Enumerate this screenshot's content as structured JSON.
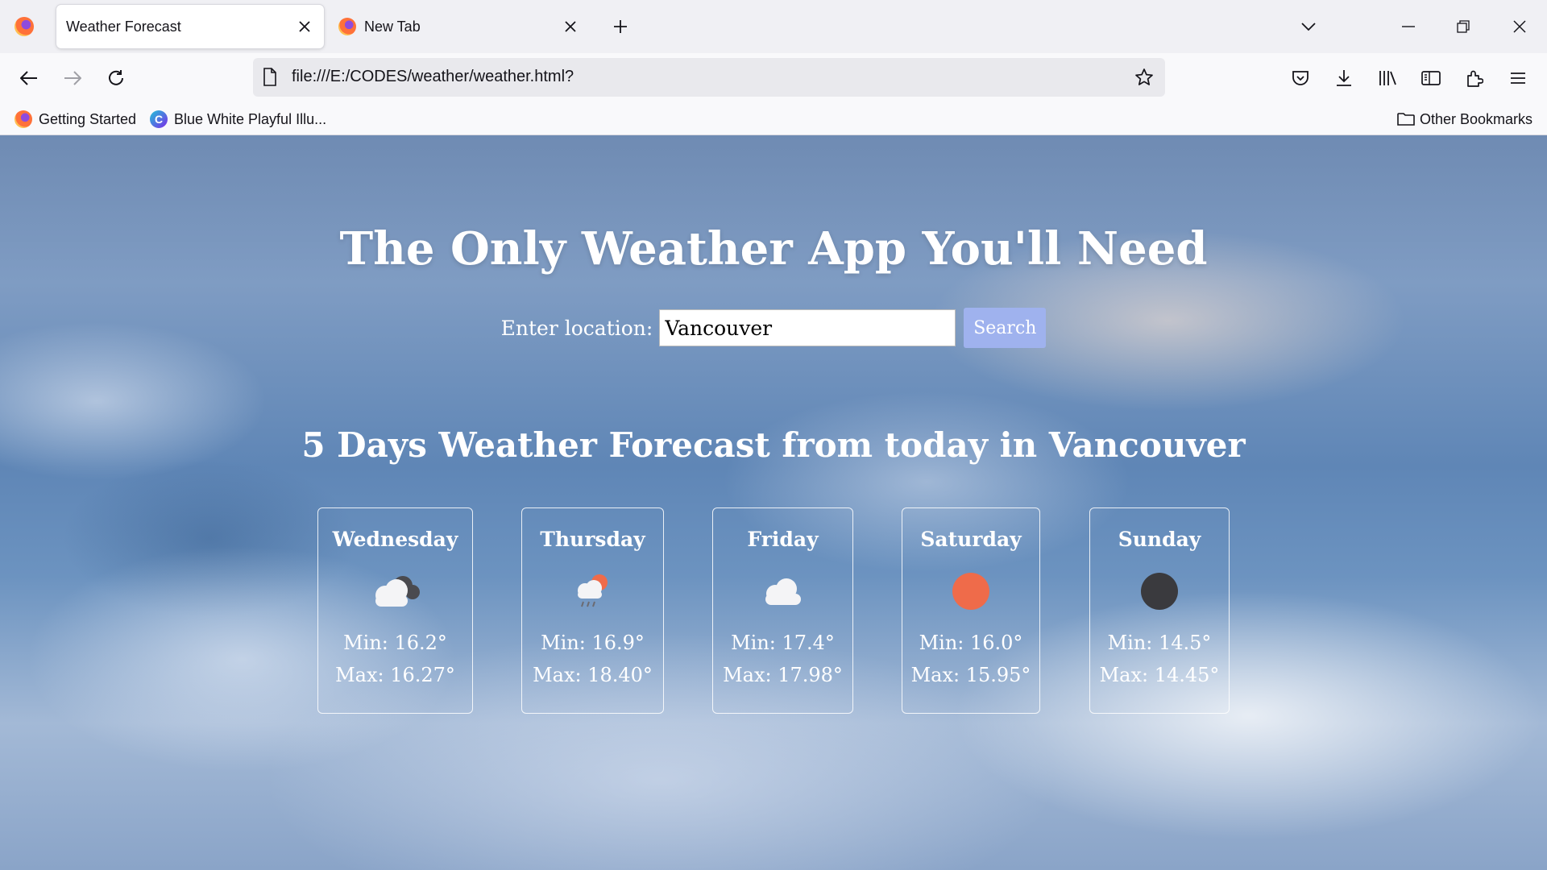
{
  "browser": {
    "tabs": [
      {
        "title": "Weather Forecast",
        "active": true
      },
      {
        "title": "New Tab",
        "active": false
      }
    ],
    "url": "file:///E:/CODES/weather/weather.html?",
    "bookmarks": [
      {
        "label": "Getting Started",
        "icon": "firefox-icon"
      },
      {
        "label": "Blue White Playful Illu...",
        "icon": "canva-icon"
      }
    ],
    "other_bookmarks": "Other Bookmarks"
  },
  "page": {
    "title": "The Only Weather App You'll Need",
    "search": {
      "label": "Enter location:",
      "value": "Vancouver",
      "button": "Search"
    },
    "forecast_title": "5 Days Weather Forecast from today in Vancouver",
    "days": [
      {
        "day": "Wednesday",
        "icon": "cloud-dark-icon",
        "min": "Min: 16.2°",
        "max": "Max: 16.27°"
      },
      {
        "day": "Thursday",
        "icon": "sun-rain-cloud-icon",
        "min": "Min: 16.9°",
        "max": "Max: 18.40°"
      },
      {
        "day": "Friday",
        "icon": "cloud-icon",
        "min": "Min: 17.4°",
        "max": "Max: 17.98°"
      },
      {
        "day": "Saturday",
        "icon": "sun-icon",
        "min": "Min: 16.0°",
        "max": "Max: 15.95°"
      },
      {
        "day": "Sunday",
        "icon": "moon-icon",
        "min": "Min: 14.5°",
        "max": "Max: 14.45°"
      }
    ]
  },
  "colors": {
    "search_button": "#9fb2ee",
    "sun": "#ef6b4a",
    "moon": "#3a3a3e"
  }
}
